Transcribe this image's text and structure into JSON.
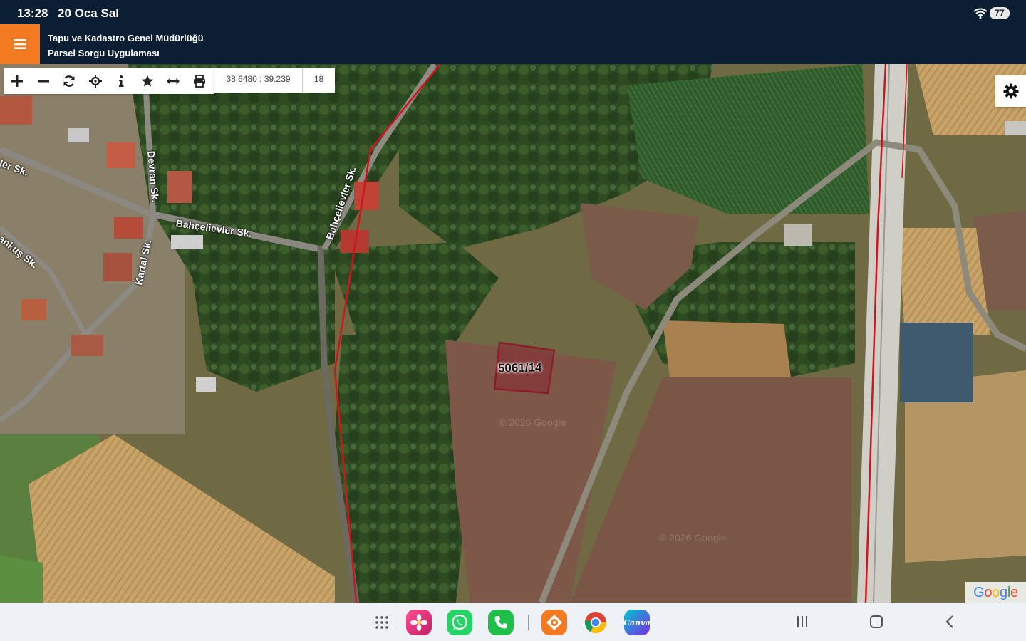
{
  "status_bar": {
    "time": "13:28",
    "date": "20 Oca Sal",
    "battery": "77"
  },
  "header": {
    "title_line1": "Tapu ve Kadastro Genel Müdürlüğü",
    "title_line2": "Parsel Sorgu Uygulaması"
  },
  "toolbar": {
    "tools": [
      "plus-icon",
      "minus-icon",
      "refresh-icon",
      "locate-icon",
      "info-icon",
      "star-icon",
      "measure-icon",
      "print-icon"
    ],
    "coordinates": "38.6480 : 39.239",
    "zoom_level": "18"
  },
  "map": {
    "streets": [
      "Bahçelievler Sk.",
      "Bahçelievler Sk.",
      "Devran Sk.",
      "Kartal Sk.",
      "ler Sk.",
      "ankuş Sk."
    ],
    "parcel_label": "5061/14",
    "attribution": "Google",
    "watermarks": [
      "© 2026 Google",
      "© 2026 Google"
    ],
    "colors": {
      "parcel_border": "#8b1c2c",
      "boundary_line": "#d0161c"
    }
  },
  "nav_bar": {
    "apps": [
      "app-drawer-icon",
      "gallery-app-icon",
      "whatsapp-app-icon",
      "phone-app-icon",
      "tkgm-app-icon",
      "chrome-app-icon",
      "canva-app-icon"
    ],
    "canva_label": "Canva"
  }
}
